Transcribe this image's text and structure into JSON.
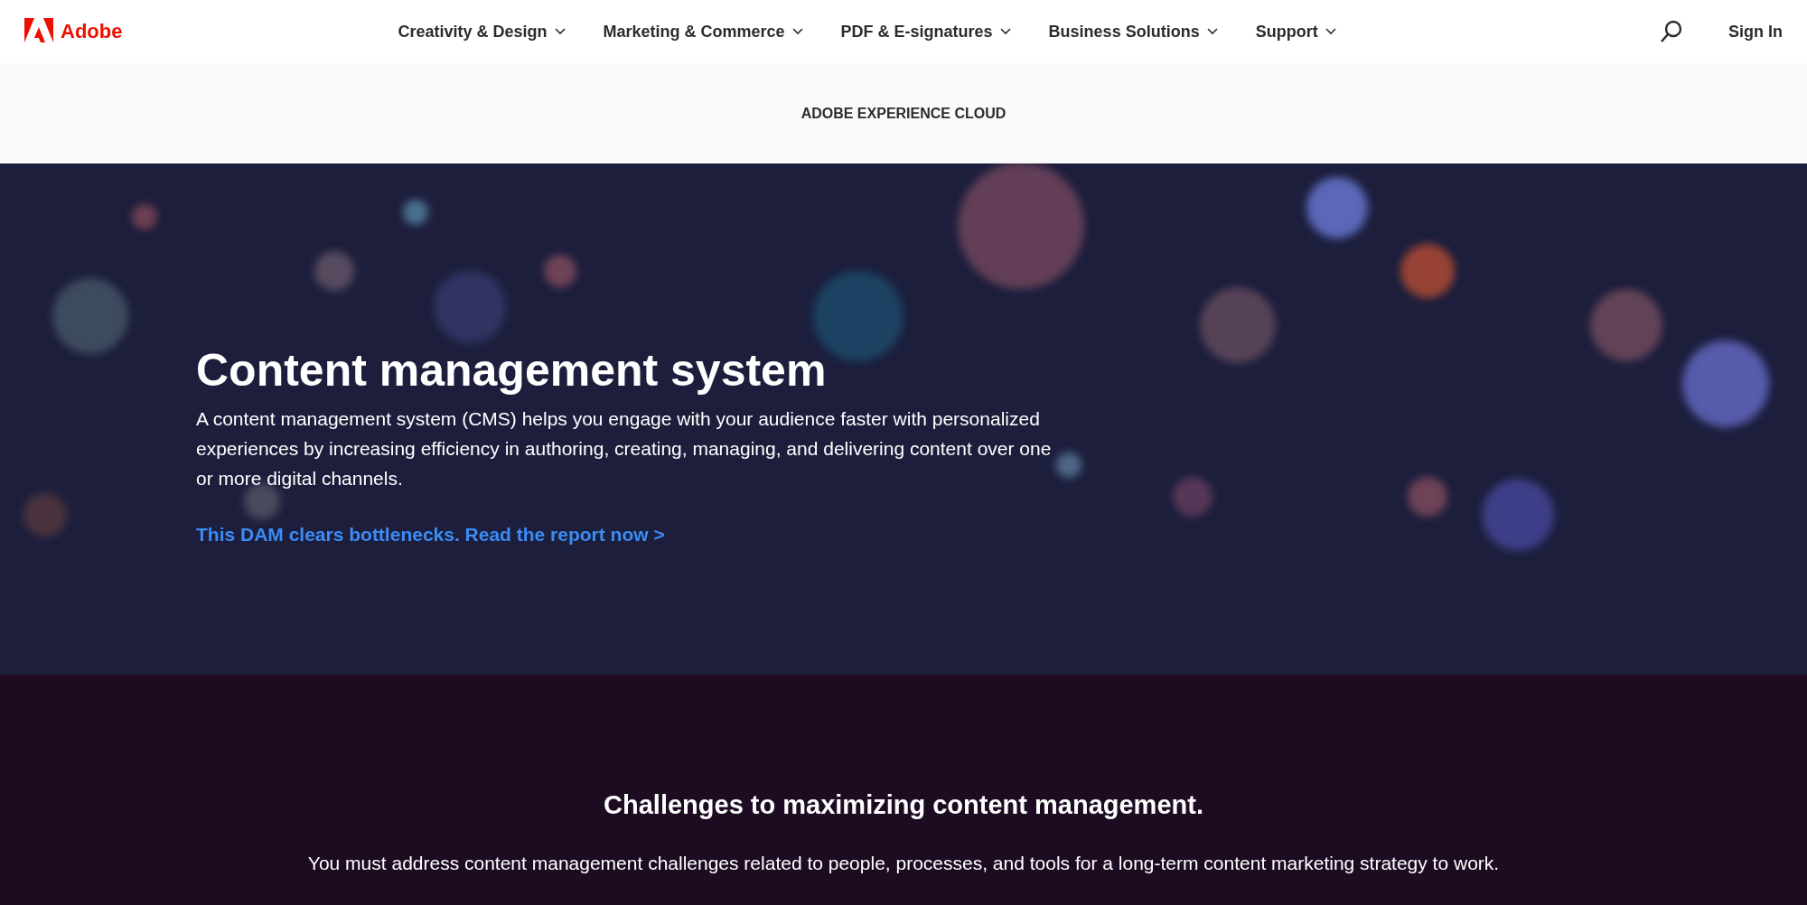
{
  "header": {
    "logo": "Adobe",
    "nav": [
      {
        "label": "Creativity & Design"
      },
      {
        "label": "Marketing & Commerce"
      },
      {
        "label": "PDF & E-signatures"
      },
      {
        "label": "Business Solutions"
      },
      {
        "label": "Support"
      }
    ],
    "sign_in": "Sign In"
  },
  "subnav": {
    "title": "ADOBE EXPERIENCE CLOUD"
  },
  "hero": {
    "title": "Content management system",
    "description": "A content management system (CMS) helps you engage with your audience faster with personalized experiences by increasing efficiency in authoring, creating, managing, and delivering content over one or more digital channels.",
    "link": "This DAM clears bottlenecks. Read the report now >"
  },
  "section": {
    "title": "Challenges to maximizing content management.",
    "text": "You must address content management challenges related to people, processes, and tools for a long-term content marketing strategy to work."
  }
}
